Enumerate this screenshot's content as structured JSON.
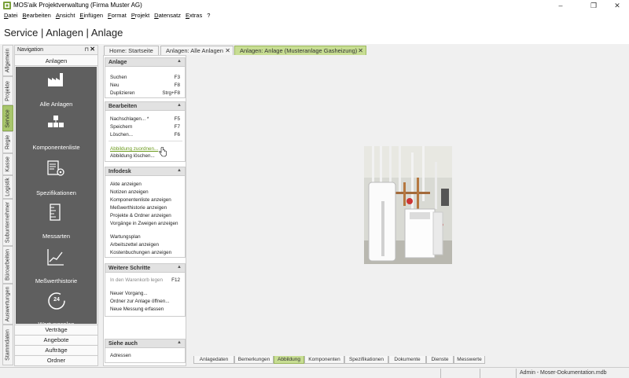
{
  "window": {
    "title": "MOS'aik Projektverwaltung (Firma Muster AG)",
    "minimize": "–",
    "restore": "❐",
    "close": "✕"
  },
  "menu": [
    "Datei",
    "Bearbeiten",
    "Ansicht",
    "Einfügen",
    "Format",
    "Projekt",
    "Datensatz",
    "Extras",
    "?"
  ],
  "header": {
    "title": "Service | Anlagen | Anlage"
  },
  "vertical_tabs": [
    "Allgemein",
    "Projekte",
    "Service",
    "Regie",
    "Kasse",
    "Logistik",
    "Subunternehmer",
    "Büroarbeiten",
    "Auswertungen",
    "Stammdaten"
  ],
  "vertical_tabs_active": "Service",
  "navigation": {
    "title": "Navigation",
    "pin": "⊓",
    "close": "✕",
    "section": "Anlagen",
    "items": [
      "Alle Anlagen",
      "Komponentenliste",
      "Spezifikationen",
      "Messarten",
      "Meßwerthistorie",
      "Wartungsplan"
    ],
    "wartung_number": "24",
    "bottom": [
      "Verträge",
      "Angebote",
      "Aufträge",
      "Ordner"
    ]
  },
  "doc_tabs": [
    {
      "label": "Home: Startseite",
      "close": ""
    },
    {
      "label": "Anlagen: Alle Anlagen",
      "close": "✕"
    },
    {
      "label": "Anlagen: Anlage (Musteranlage Gasheizung)",
      "close": "✕"
    }
  ],
  "actions": {
    "collapse_icon": "▲",
    "anlage": {
      "title": "Anlage",
      "items": [
        {
          "label": "Suchen",
          "shortcut": "F3"
        },
        {
          "label": "Neu",
          "shortcut": "F8"
        },
        {
          "label": "Duplizieren",
          "shortcut": "Strg+F8"
        }
      ]
    },
    "bearbeiten": {
      "title": "Bearbeiten",
      "items": [
        {
          "label": "Nachschlagen... *",
          "shortcut": "F5"
        },
        {
          "label": "Speichern",
          "shortcut": "F7"
        },
        {
          "label": "Löschen...",
          "shortcut": "F6"
        },
        {
          "label": "Abbildung zuordnen...",
          "shortcut": ""
        },
        {
          "label": "Abbildung löschen...",
          "shortcut": ""
        }
      ]
    },
    "infodesk": {
      "title": "Infodesk",
      "items": [
        "Akte anzeigen",
        "Notizen anzeigen",
        "Komponentenliste anzeigen",
        "Meßwerthistorie anzeigen",
        "Projekte & Ordner anzeigen",
        "Vorgänge in Zweigen anzeigen",
        "Wartungsplan",
        "Arbeitszettel anzeigen",
        "Kostenbuchungen anzeigen"
      ]
    },
    "weitere": {
      "title": "Weitere Schritte",
      "items": [
        {
          "label": "In den Warenkorb legen",
          "shortcut": "F12"
        },
        {
          "label": "Neuer Vorgang...",
          "shortcut": ""
        },
        {
          "label": "Ordner zur Anlage öffnen...",
          "shortcut": ""
        },
        {
          "label": "Neue Messung erfassen",
          "shortcut": ""
        }
      ]
    },
    "siehe": {
      "title": "Siehe auch",
      "items": [
        "Adressen"
      ]
    }
  },
  "bottom_tabs": [
    "Anlagedaten",
    "Bemerkungen",
    "Abbildung",
    "Komponenten",
    "Spezifikationen",
    "Dokumente",
    "Dienste",
    "Messwerte"
  ],
  "bottom_tabs_active": "Abbildung",
  "status": {
    "text": "Admin - Moser-Dokumentation.mdb"
  },
  "colors": {
    "accent": "#a8c66c",
    "nav_dark": "#5f5f5f",
    "link": "#6b9a1c"
  }
}
